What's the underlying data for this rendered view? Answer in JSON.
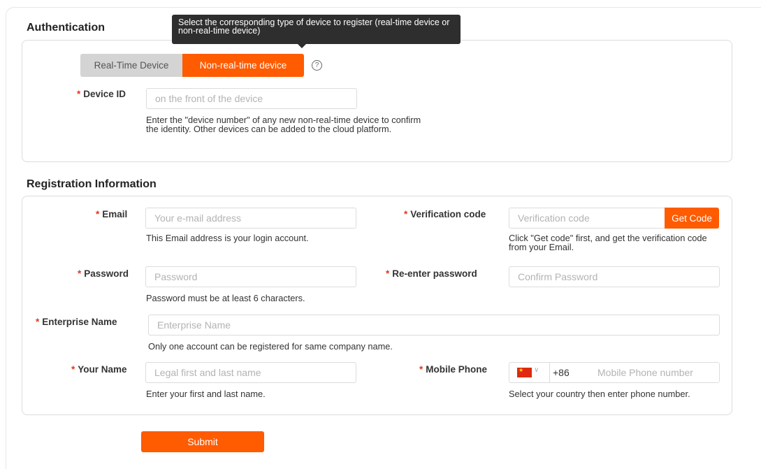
{
  "tooltip": "Select the corresponding type of device to register (real-time device or non-real-time device)",
  "authentication": {
    "title": "Authentication",
    "device_types": [
      "Real-Time Device",
      "Non-real-time device"
    ],
    "selected_device_type": "Non-real-time device",
    "help_icon": "question-circle-icon",
    "device_id": {
      "label": "Device ID",
      "placeholder": "on the front of the device",
      "value": "",
      "hint": "Enter the \"device number\" of any new non-real-time device to confirm the identity. Other devices can be added to the cloud platform."
    }
  },
  "registration": {
    "title": "Registration Information",
    "email": {
      "label": "Email",
      "placeholder": "Your e-mail address",
      "value": "",
      "hint": "This Email address is your login account."
    },
    "verification": {
      "label": "Verification code",
      "placeholder": "Verification code",
      "value": "",
      "button": "Get Code",
      "hint": "Click \"Get code\" first, and get the verification code from your Email."
    },
    "password": {
      "label": "Password",
      "placeholder": "Password",
      "value": "",
      "hint": "Password must be at least 6 characters."
    },
    "reenter_password": {
      "label": "Re-enter password",
      "placeholder": "Confirm Password",
      "value": ""
    },
    "enterprise_name": {
      "label": "Enterprise Name",
      "placeholder": "Enterprise Name",
      "value": "",
      "hint": "Only one account can be registered for same company name."
    },
    "your_name": {
      "label": "Your Name",
      "placeholder": "Legal first and last name",
      "value": "",
      "hint": "Enter your first and last name."
    },
    "mobile_phone": {
      "label": "Mobile Phone",
      "country_flag": "china-flag-icon",
      "country_code": "+86",
      "placeholder": "Mobile Phone number",
      "value": "",
      "hint": "Select your country then enter phone number."
    }
  },
  "submit_label": "Submit",
  "required_mark": "*",
  "colors": {
    "accent": "#ff5b00",
    "required": "#e5361b",
    "tooltip_bg": "#2e2e2e",
    "segment_inactive": "#d4d4d4"
  }
}
